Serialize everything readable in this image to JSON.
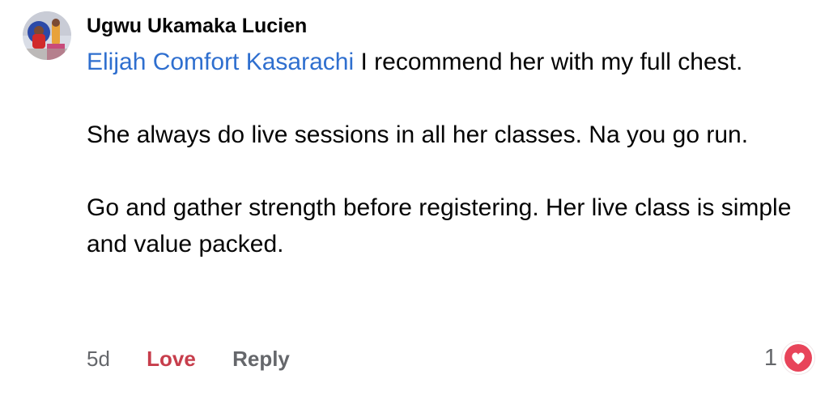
{
  "comment": {
    "author": "Ugwu Ukamaka Lucien",
    "mention": "Elijah Comfort Kasarachi",
    "paragraph1_rest": " I recommend her with my full chest.",
    "paragraph2": "She always do live sessions in all her classes. Na you go run.",
    "paragraph3": "Go and gather strength before registering. Her live class is simple and value packed."
  },
  "actions": {
    "time": "5d",
    "love_label": "Love",
    "reply_label": "Reply"
  },
  "reactions": {
    "count": "1",
    "icon": "heart-reaction-icon",
    "color": "#e8445a"
  },
  "colors": {
    "mention": "#2f6fcf",
    "love": "#c73e4c",
    "muted": "#65676b"
  }
}
